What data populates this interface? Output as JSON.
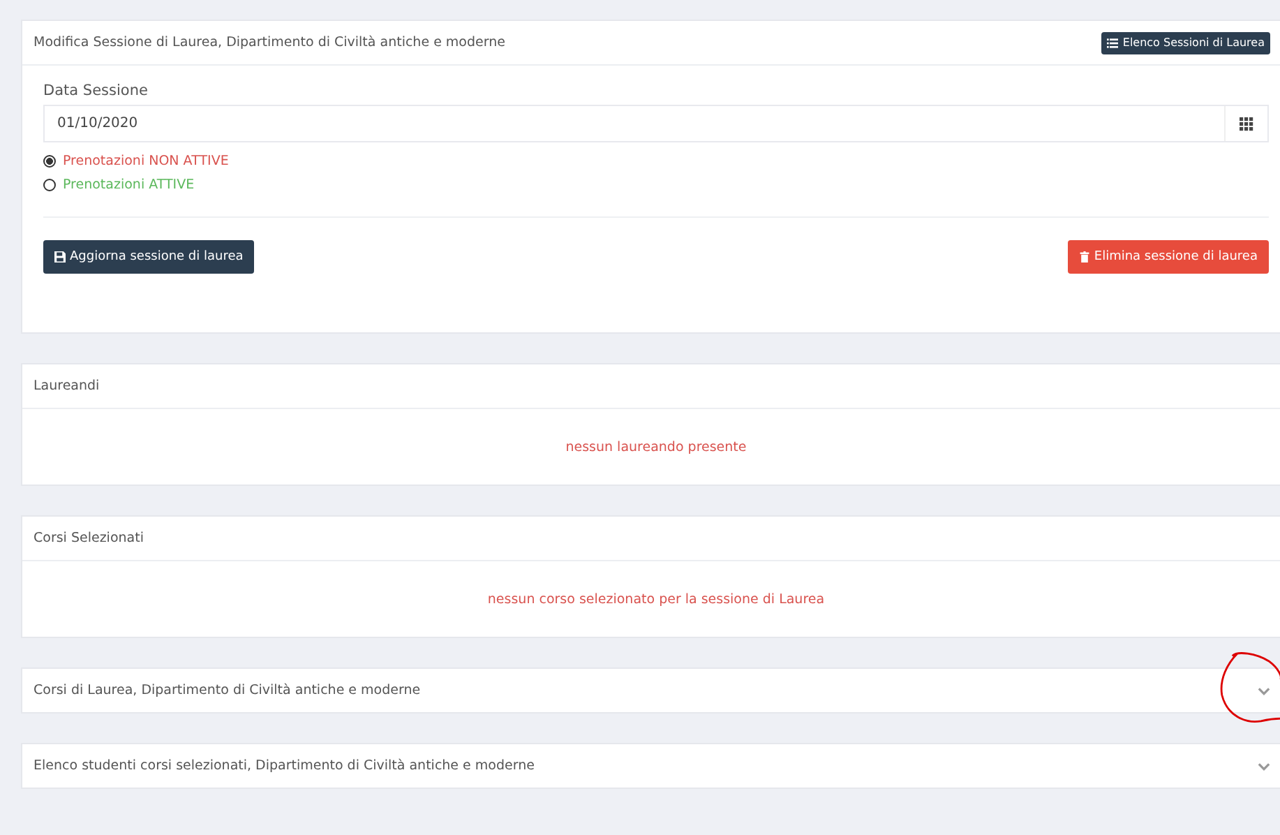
{
  "edit_panel": {
    "title": "Modifica Sessione di Laurea, Dipartimento di Civiltà antiche e moderne",
    "header_button": "Elenco Sessioni di Laurea",
    "date_field": {
      "label": "Data Sessione",
      "value": "01/10/2020"
    },
    "booking_options": [
      {
        "label": "Prenotazioni NON ATTIVE",
        "selected": true,
        "color": "#d9534f"
      },
      {
        "label": "Prenotazioni ATTIVE",
        "selected": false,
        "color": "#5cb85c"
      }
    ],
    "actions": [
      {
        "kind": "save",
        "label": "Aggiorna sessione di laurea"
      },
      {
        "kind": "delete",
        "label": "Elimina sessione di laurea"
      }
    ]
  },
  "list_panels": [
    {
      "title": "Laureandi",
      "message": "nessun laureando presente"
    },
    {
      "title": "Corsi Selezionati",
      "message": "nessun corso selezionato per la sessione di Laurea"
    }
  ],
  "collapsible_panels": [
    {
      "title": "Corsi di Laurea, Dipartimento di Civiltà antiche e moderne",
      "expanded": false
    },
    {
      "title": "Elenco studenti corsi selezionati, Dipartimento di Civiltà antiche e moderne",
      "expanded": false
    }
  ]
}
